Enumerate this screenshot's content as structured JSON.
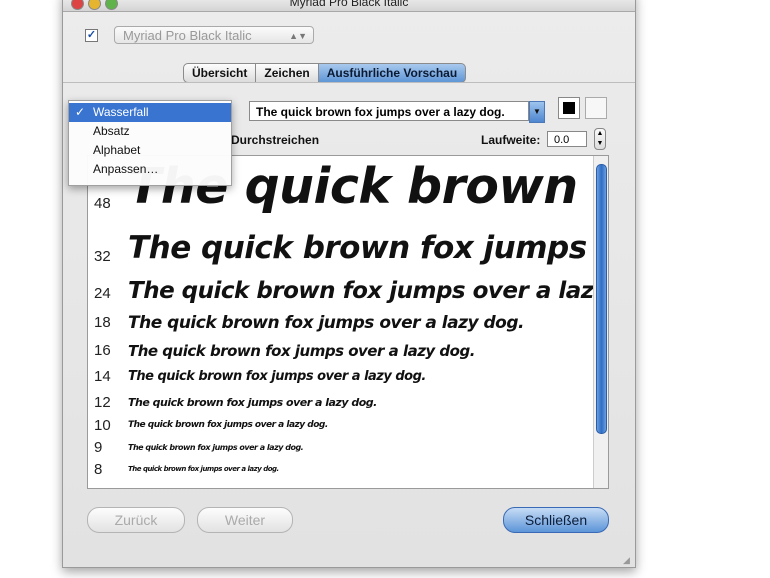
{
  "window": {
    "title": "Myriad Pro Black Italic"
  },
  "font_selector": {
    "enabled": true,
    "value": "Myriad Pro Black Italic"
  },
  "tabs": [
    {
      "label": "Übersicht",
      "selected": false
    },
    {
      "label": "Zeichen",
      "selected": false
    },
    {
      "label": "Ausführliche Vorschau",
      "selected": true
    }
  ],
  "preview_text": {
    "value": "The quick brown fox jumps over a lazy dog."
  },
  "options": {
    "strikethrough_label": "Durchstreichen",
    "tracking_label": "Laufweite:",
    "tracking_value": "0.0"
  },
  "mode_menu": {
    "selected_marker": "✓",
    "items": [
      {
        "label": "Wasserfall",
        "selected": true
      },
      {
        "label": "Absatz",
        "selected": false
      },
      {
        "label": "Alphabet",
        "selected": false
      },
      {
        "label": "Anpassen…",
        "selected": false
      }
    ]
  },
  "waterfall": [
    {
      "size": "48",
      "sample": "The quick brown fox jumps over a lazy dog."
    },
    {
      "size": "32",
      "sample": "The quick brown fox jumps over a lazy dog."
    },
    {
      "size": "24",
      "sample": "The quick brown fox jumps over a lazy dog."
    },
    {
      "size": "18",
      "sample": "The quick brown fox jumps over a lazy dog."
    },
    {
      "size": "16",
      "sample": "The quick brown fox jumps over a lazy dog."
    },
    {
      "size": "14",
      "sample": "The quick brown fox jumps over a lazy dog."
    },
    {
      "size": "12",
      "sample": "The quick brown fox jumps over a lazy dog."
    },
    {
      "size": "10",
      "sample": "The quick brown fox jumps over a lazy dog."
    },
    {
      "size": "9",
      "sample": "The quick brown fox jumps over a lazy dog."
    },
    {
      "size": "8",
      "sample": "The quick brown fox jumps over a lazy dog."
    }
  ],
  "buttons": {
    "back": "Zurück",
    "next": "Weiter",
    "close": "Schließen"
  },
  "colors": {
    "accent": "#3974d1",
    "selected_tab": "#5f96d6"
  }
}
